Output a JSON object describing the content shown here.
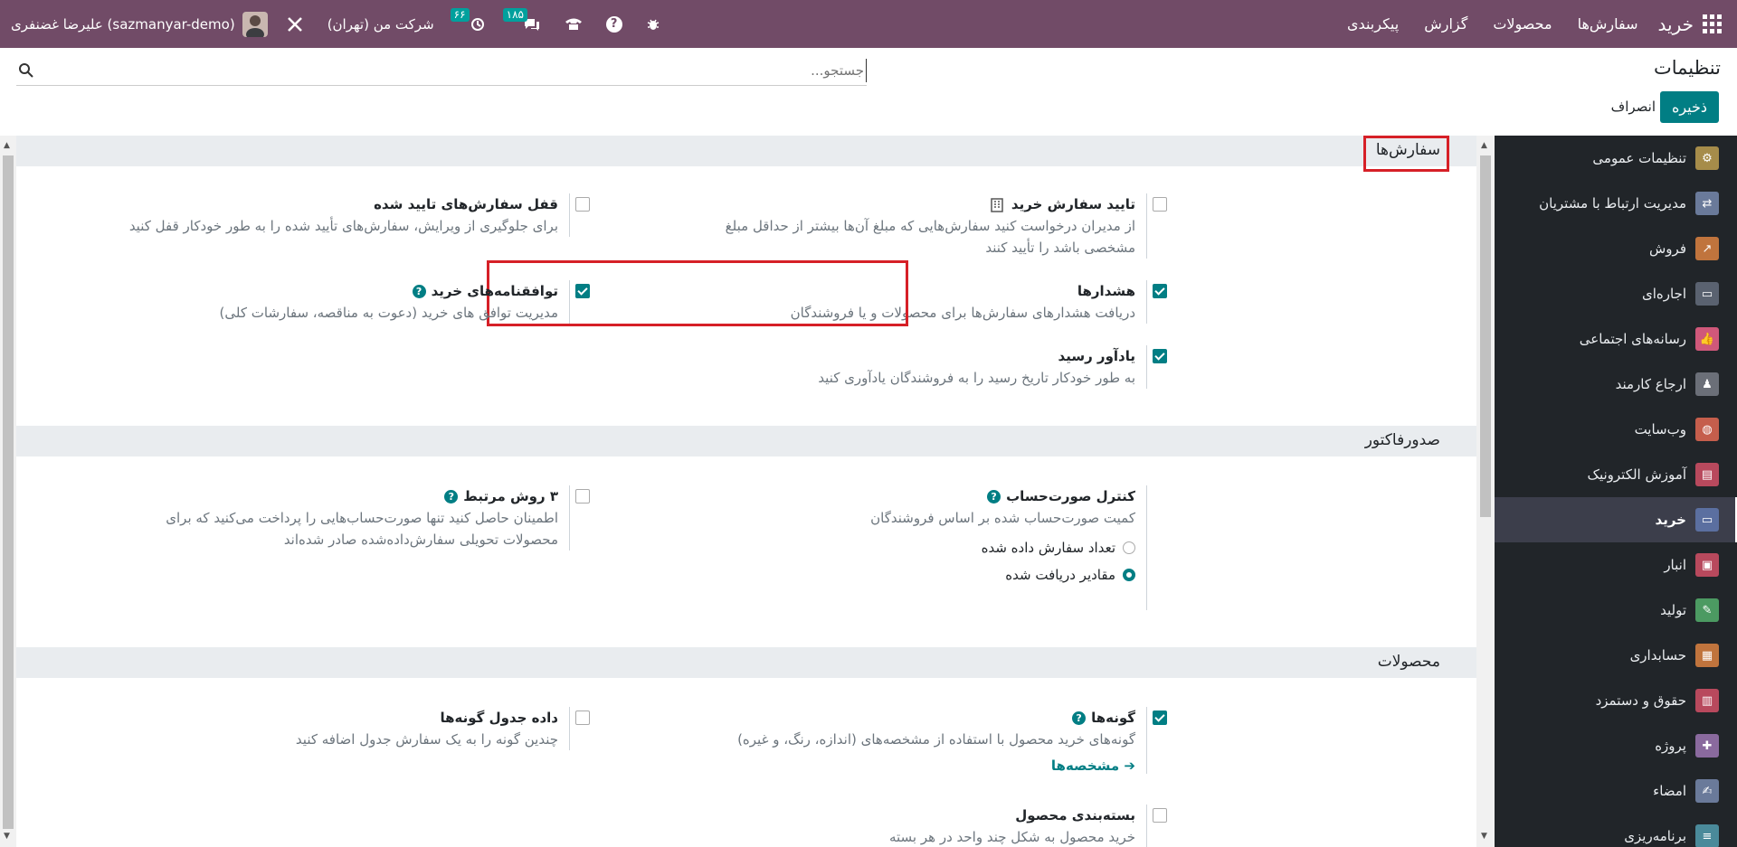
{
  "topbar": {
    "brand": "خرید",
    "menu": [
      "سفارش‌ها",
      "محصولات",
      "گزارش",
      "پیکربندی"
    ],
    "user": "علیرضا غضنفری (sazmanyar-demo)",
    "company": "شرکت من (تهران)",
    "activity_badge": "۶۶",
    "messages_badge": "۱۸۵"
  },
  "control_panel": {
    "title": "تنظیمات",
    "search_placeholder": "جستجو...",
    "save": "ذخیره",
    "cancel": "انصراف"
  },
  "sidebar": {
    "items": [
      {
        "label": "تنظیمات عمومی",
        "icon": "gear-icon",
        "color": "#a68c4a"
      },
      {
        "label": "مدیریت ارتباط با مشتریان",
        "icon": "handshake-icon",
        "color": "#6a7a9a"
      },
      {
        "label": "فروش",
        "icon": "chart-icon",
        "color": "#c0743d"
      },
      {
        "label": "اجاره‌ای",
        "icon": "monitor-icon",
        "color": "#5a6270"
      },
      {
        "label": "رسانه‌های اجتماعی",
        "icon": "thumbs-up-icon",
        "color": "#d0587a"
      },
      {
        "label": "ارجاع کارمند",
        "icon": "person-icon",
        "color": "#6b6f78"
      },
      {
        "label": "وب‌سایت",
        "icon": "globe-icon",
        "color": "#c55e4c"
      },
      {
        "label": "آموزش الکترونیک",
        "icon": "elearning-icon",
        "color": "#b8495d"
      },
      {
        "label": "خرید",
        "icon": "card-icon",
        "color": "#5b6fa0"
      },
      {
        "label": "انبار",
        "icon": "box-icon",
        "color": "#b8495d"
      },
      {
        "label": "تولید",
        "icon": "wrench-icon",
        "color": "#4c9a62"
      },
      {
        "label": "حسابداری",
        "icon": "calculator-icon",
        "color": "#c0743d"
      },
      {
        "label": "حقوق و دستمزد",
        "icon": "payroll-icon",
        "color": "#b8495d"
      },
      {
        "label": "پروژه",
        "icon": "puzzle-icon",
        "color": "#8a6a9e"
      },
      {
        "label": "امضاء",
        "icon": "signature-icon",
        "color": "#6a7a9a"
      },
      {
        "label": "برنامه‌ریزی",
        "icon": "list-icon",
        "color": "#4a8a9a"
      }
    ]
  },
  "sections": {
    "orders": "سفارش‌ها",
    "invoicing": "صدورفاکتور",
    "products": "محصولات"
  },
  "settings": {
    "po_approval": {
      "label": "تایید سفارش خرید",
      "desc1": "از مدیران درخواست کنید سفارش‌هایی که مبلغ آن‌ها بیشتر از حداقل مبلغ",
      "desc2": "مشخصی باشد را تأیید کنند"
    },
    "lock_orders": {
      "label": "قفل سفارش‌های تایید شده",
      "desc1": "برای جلوگیری از ویرایش، سفارش‌های تأیید شده را به طور خودکار قفل کنید"
    },
    "warnings": {
      "label": "هشدارها",
      "desc1": "دریافت هشدارهای سفارش‌ها برای محصولات و یا فروشندگان"
    },
    "agreements": {
      "label": "توافقنامه‌های خرید",
      "desc1": "مدیریت توافق های خرید (دعوت به مناقصه، سفارشات کلی)"
    },
    "receipt_reminder": {
      "label": "یادآور رسید",
      "desc1": "به طور خودکار تاریخ رسید را به فروشندگان یادآوری کنید"
    },
    "bill_control": {
      "label": "کنترل صورت‌حساب",
      "desc1": "کمیت صورت‌حساب شده بر اساس فروشندگان",
      "radio1": "تعداد سفارش داده شده",
      "radio2": "مقادیر دریافت شده"
    },
    "three_way": {
      "label": "۳ روش مرتبط",
      "desc1": "اطمینان حاصل کنید تنها صورت‌حساب‌هایی را پرداخت می‌کنید که برای",
      "desc2": "محصولات تحویلی سفارش‌داده‌شده صادر شده‌اند"
    },
    "variants": {
      "label": "گونه‌ها",
      "desc1": "گونه‌های خرید محصول با استفاده از مشخصه‌های (اندازه، رنگ، و غیره)",
      "link": "مشخصه‌ها"
    },
    "variant_grid": {
      "label": "داده جدول گونه‌ها",
      "desc1": "چندین گونه را به یک سفارش جدول اضافه کنید"
    },
    "packaging": {
      "label": "بسته‌بندی محصول",
      "desc1": "خرید محصول به شکل چند واحد در هر بسته"
    }
  }
}
